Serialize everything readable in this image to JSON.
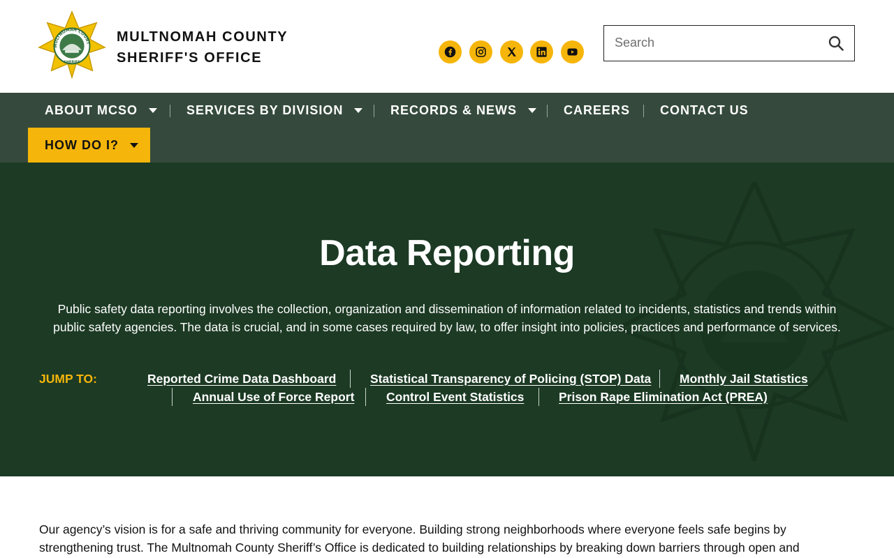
{
  "header": {
    "org_line1": "MULTNOMAH COUNTY",
    "org_line2": "SHERIFF'S OFFICE",
    "logo_text_top": "MULTNOMAH COUNTY",
    "logo_text_bottom": "SHERIFF",
    "social_icons": [
      "facebook-icon",
      "instagram-icon",
      "x-icon",
      "linkedin-icon",
      "youtube-icon"
    ],
    "search_placeholder": "Search"
  },
  "nav": {
    "items": [
      {
        "label": "ABOUT MCSO",
        "has_dropdown": true
      },
      {
        "label": "SERVICES BY DIVISION",
        "has_dropdown": true
      },
      {
        "label": "RECORDS & NEWS",
        "has_dropdown": true
      },
      {
        "label": "CAREERS",
        "has_dropdown": false
      },
      {
        "label": "CONTACT US",
        "has_dropdown": false
      }
    ],
    "highlight": {
      "label": "HOW DO I?",
      "has_dropdown": true
    }
  },
  "hero": {
    "title": "Data Reporting",
    "description": "Public safety data reporting involves the collection, organization and dissemination of information related to incidents, statistics and trends within public safety agencies. The data is crucial, and in some cases required by law, to offer insight into policies, practices and performance of services.",
    "jump_label": "JUMP TO:",
    "links": [
      "Reported Crime Data Dashboard",
      "Statistical Transparency of Policing (STOP) Data",
      "Monthly Jail Statistics",
      "Annual Use of Force Report",
      "Control Event Statistics",
      "Prison Rape Elimination Act (PREA)"
    ]
  },
  "body": {
    "paragraph": "Our agency’s vision is for a safe and thriving community for everyone. Building strong neighborhoods where everyone feels safe begins by strengthening trust.  The Multnomah County Sheriff’s Office is dedicated to building relationships by breaking down barriers through open and"
  },
  "colors": {
    "accent_yellow": "#f5b50a",
    "nav_green": "#354a3c",
    "hero_green": "#1c3a24"
  }
}
